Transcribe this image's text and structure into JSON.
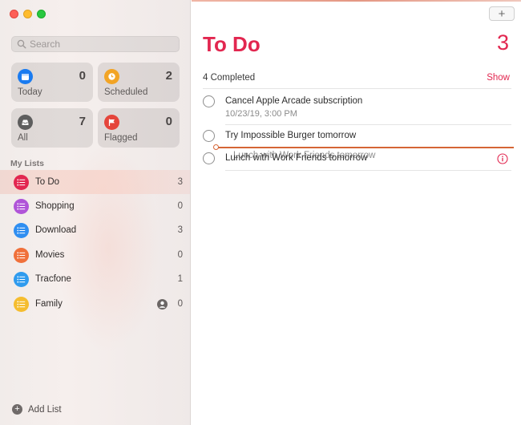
{
  "sidebar": {
    "search_placeholder": "Search",
    "smart_lists": [
      {
        "label": "Today",
        "count": "0",
        "icon": "calendar-icon",
        "color": "#1a7bf0"
      },
      {
        "label": "Scheduled",
        "count": "2",
        "icon": "clock-icon",
        "color": "#f2a425"
      },
      {
        "label": "All",
        "count": "7",
        "icon": "tray-icon",
        "color": "#5e5e5e"
      },
      {
        "label": "Flagged",
        "count": "0",
        "icon": "flag-icon",
        "color": "#e5453b"
      }
    ],
    "section_title": "My Lists",
    "lists": [
      {
        "name": "To Do",
        "count": "3",
        "color": "#e22750",
        "selected": true
      },
      {
        "name": "Shopping",
        "count": "0",
        "color": "#b054d8"
      },
      {
        "name": "Download",
        "count": "3",
        "color": "#2f8ef1"
      },
      {
        "name": "Movies",
        "count": "0",
        "color": "#f0703a"
      },
      {
        "name": "Tracfone",
        "count": "1",
        "color": "#2f9bee"
      },
      {
        "name": "Family",
        "count": "0",
        "color": "#f5bd2f",
        "shared": true
      }
    ],
    "add_list_label": "Add List"
  },
  "main": {
    "add_button_label": "+",
    "title": "To Do",
    "count": "3",
    "completed_text": "4 Completed",
    "show_label": "Show",
    "tasks": [
      {
        "text": "Cancel Apple Arcade subscription",
        "subtext": "10/23/19, 3:00 PM"
      },
      {
        "text": "Try Impossible Burger tomorrow"
      },
      {
        "text": "Lunch with Work Friends tomorrow"
      }
    ],
    "dragging_text": "Lunch with Work Friends tomorrow",
    "accent_color": "#e22750"
  }
}
